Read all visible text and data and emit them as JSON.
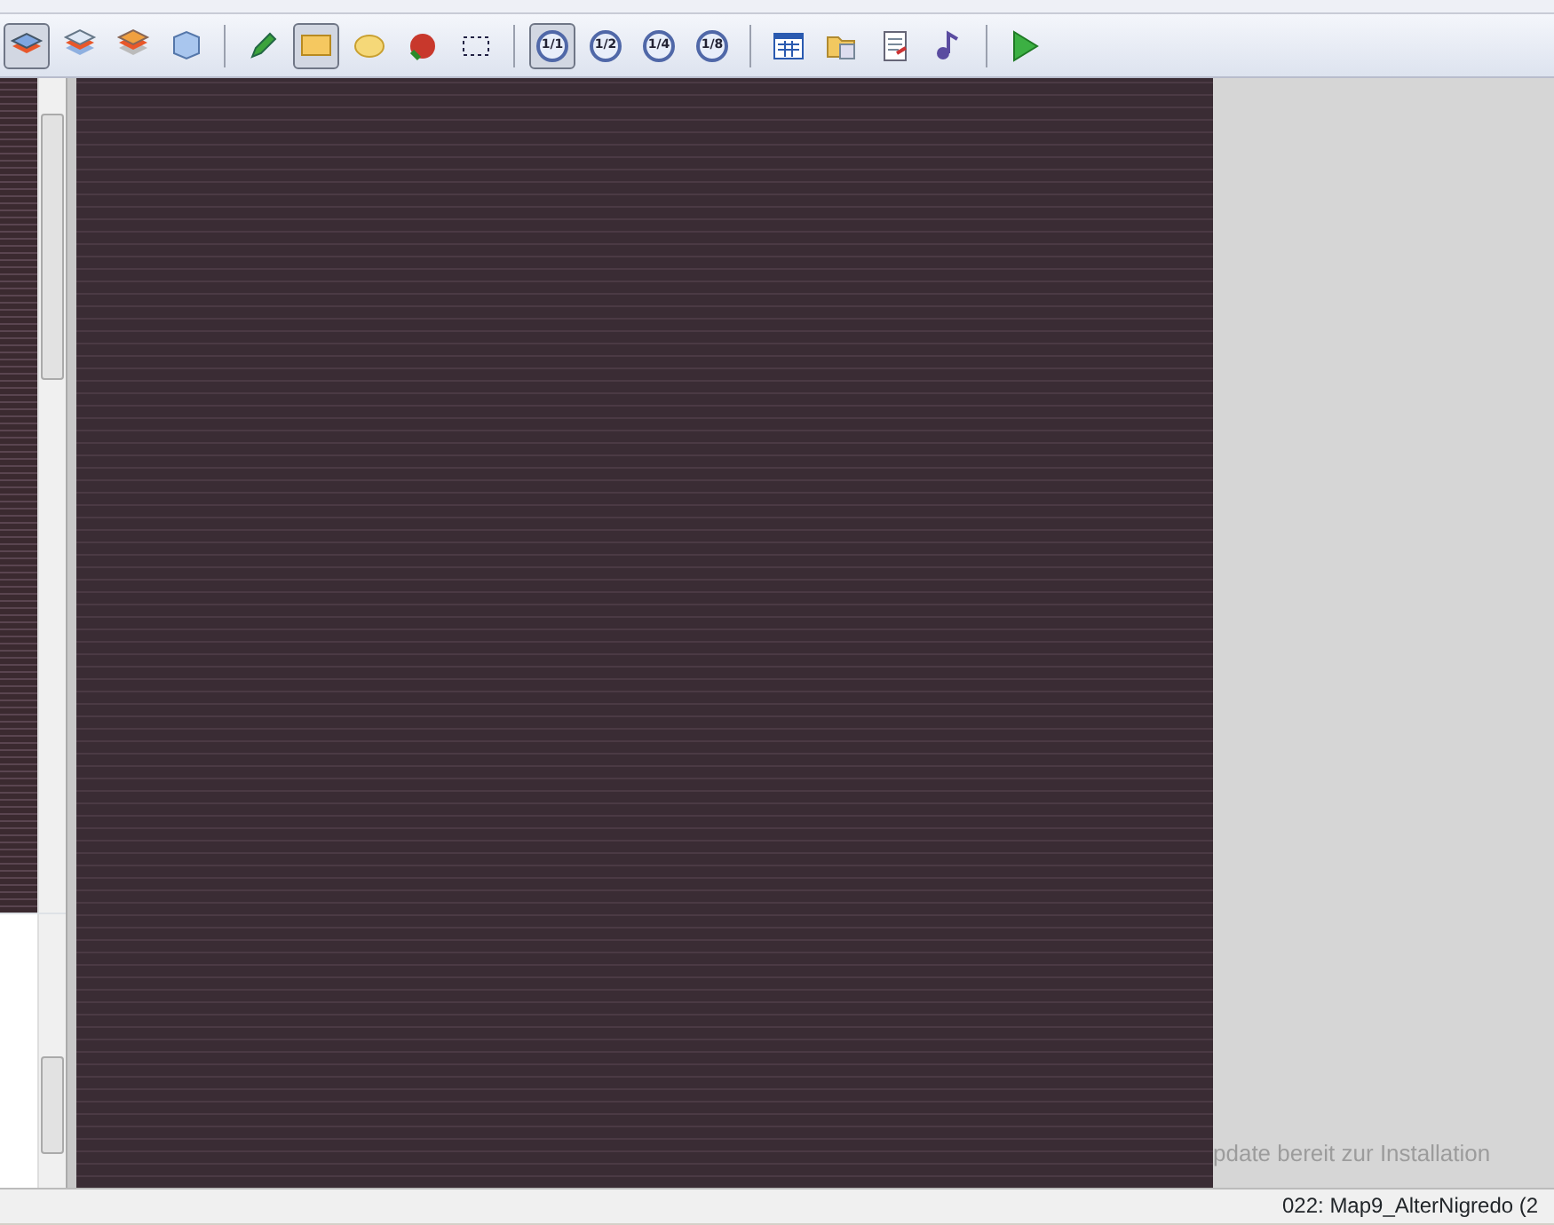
{
  "toolbar": {
    "groups": [
      [
        {
          "kind": "layer-1",
          "selected": true
        },
        {
          "kind": "layer-2",
          "selected": false
        },
        {
          "kind": "layer-3",
          "selected": false
        },
        {
          "kind": "events",
          "selected": false
        }
      ],
      [
        {
          "kind": "pencil",
          "selected": false
        },
        {
          "kind": "rectangle",
          "selected": true
        },
        {
          "kind": "ellipse",
          "selected": false
        },
        {
          "kind": "fill",
          "selected": false
        },
        {
          "kind": "select",
          "selected": false
        }
      ],
      [
        {
          "kind": "zoom",
          "label": "1/1",
          "selected": true
        },
        {
          "kind": "zoom",
          "label": "1/2",
          "selected": false
        },
        {
          "kind": "zoom",
          "label": "1/4",
          "selected": false
        },
        {
          "kind": "zoom",
          "label": "1/8",
          "selected": false
        }
      ],
      [
        {
          "kind": "database",
          "selected": false
        },
        {
          "kind": "materials",
          "selected": false
        },
        {
          "kind": "script",
          "selected": false
        },
        {
          "kind": "sound",
          "selected": false
        }
      ],
      [
        {
          "kind": "play",
          "selected": false
        }
      ]
    ]
  },
  "notification": {
    "title": "pdate bereit zur Installation"
  },
  "status_bar": {
    "map": "022: Map9_AlterNigredo (2"
  }
}
